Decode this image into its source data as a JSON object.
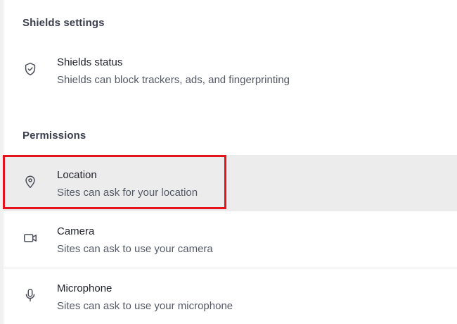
{
  "shields_section": {
    "title": "Shields settings",
    "items": [
      {
        "icon": "shield-check-icon",
        "label": "Shields status",
        "description": "Shields can block trackers, ads, and fingerprinting"
      }
    ]
  },
  "permissions_section": {
    "title": "Permissions",
    "items": [
      {
        "icon": "location-pin-icon",
        "label": "Location",
        "description": "Sites can ask for your location"
      },
      {
        "icon": "camera-icon",
        "label": "Camera",
        "description": "Sites can ask to use your camera"
      },
      {
        "icon": "microphone-icon",
        "label": "Microphone",
        "description": "Sites can ask to use your microphone"
      }
    ]
  },
  "colors": {
    "highlight_border": "#e3141b",
    "hover_row_background": "#ececec",
    "title_text": "#1f2128",
    "description_text": "#545965",
    "section_header_text": "#3b3e4f"
  }
}
